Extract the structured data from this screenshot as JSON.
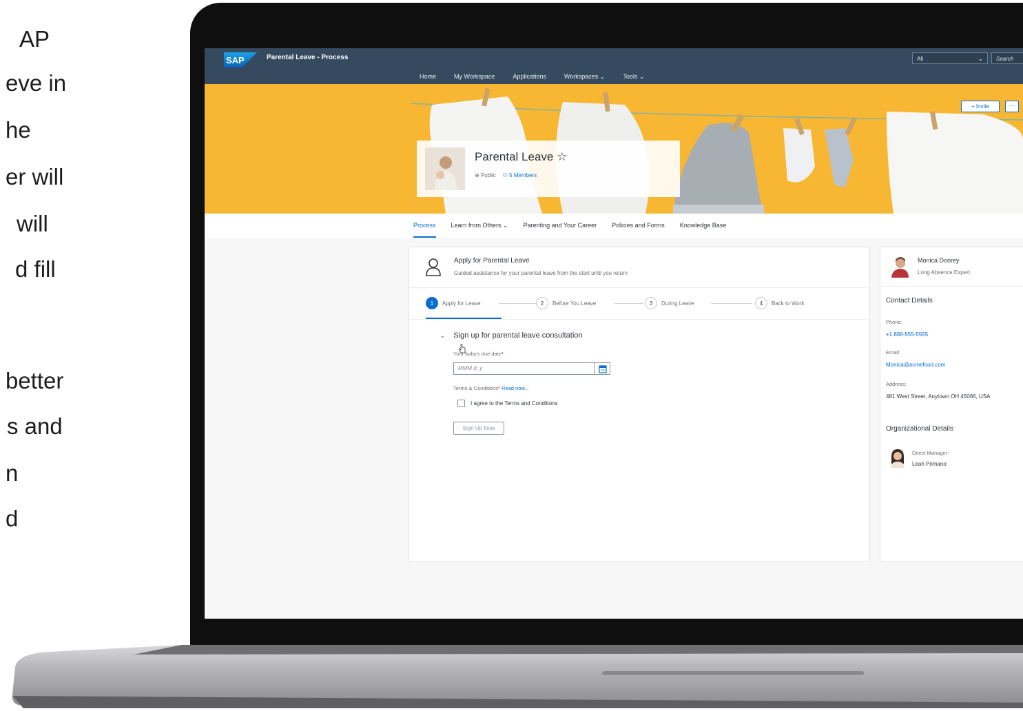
{
  "slide_text": [
    "AP",
    "eve in",
    "he",
    "er will",
    "will",
    "d fill",
    "better",
    "s and",
    "n",
    "d"
  ],
  "shell": {
    "logo": "SAP",
    "title": "Parental Leave - Process",
    "nav": [
      "Home",
      "My Workspace",
      "Applications",
      "Workspaces ⌄",
      "Tools ⌄"
    ],
    "search_scope": "All",
    "search_placeholder": "Search"
  },
  "banner": {
    "invite_label": "+ Invite",
    "more_label": "···",
    "workspace_title": "Parental Leave ☆",
    "visibility": "Public",
    "members": "5 Members"
  },
  "tabs": [
    {
      "label": "Process",
      "active": true
    },
    {
      "label": "Learn from Others ⌄"
    },
    {
      "label": "Parenting and Your Career"
    },
    {
      "label": "Policies and Forms"
    },
    {
      "label": "Knowledge Base"
    }
  ],
  "process": {
    "title": "Apply for Parental Leave",
    "subtitle": "Guided assistance for your parental leave from the start until you return",
    "steps": [
      {
        "num": "1",
        "label": "Apply for Leave"
      },
      {
        "num": "2",
        "label": "Before You Leave"
      },
      {
        "num": "3",
        "label": "During Leave"
      },
      {
        "num": "4",
        "label": "Back to Work"
      }
    ],
    "section_title": "Sign up for parental leave consultation",
    "due_date_label": "Your baby's due date",
    "due_date_placeholder": "MMM d, y",
    "terms_label": "Terms & Conditions",
    "read_now": "Read now...",
    "agree_label": "I agree to the Terms and Conditions",
    "signup_label": "Sign Up Now"
  },
  "expert": {
    "name": "Monica Doorey",
    "role": "Long Absence Expert",
    "contact_heading": "Contact Details",
    "phone_label": "Phone:",
    "phone": "+1 888-555-5555",
    "email_label": "Email:",
    "email": "Monica@acmefood.com",
    "address_label": "Address:",
    "address": "481 West Street, Anytown OH 45066, USA",
    "org_heading": "Organizational Details",
    "manager_label": "Direct Manager:",
    "manager": "Leah Primano"
  },
  "colors": {
    "shell": "#354a5f",
    "banner": "#f7b733",
    "accent": "#0a6ed1"
  }
}
